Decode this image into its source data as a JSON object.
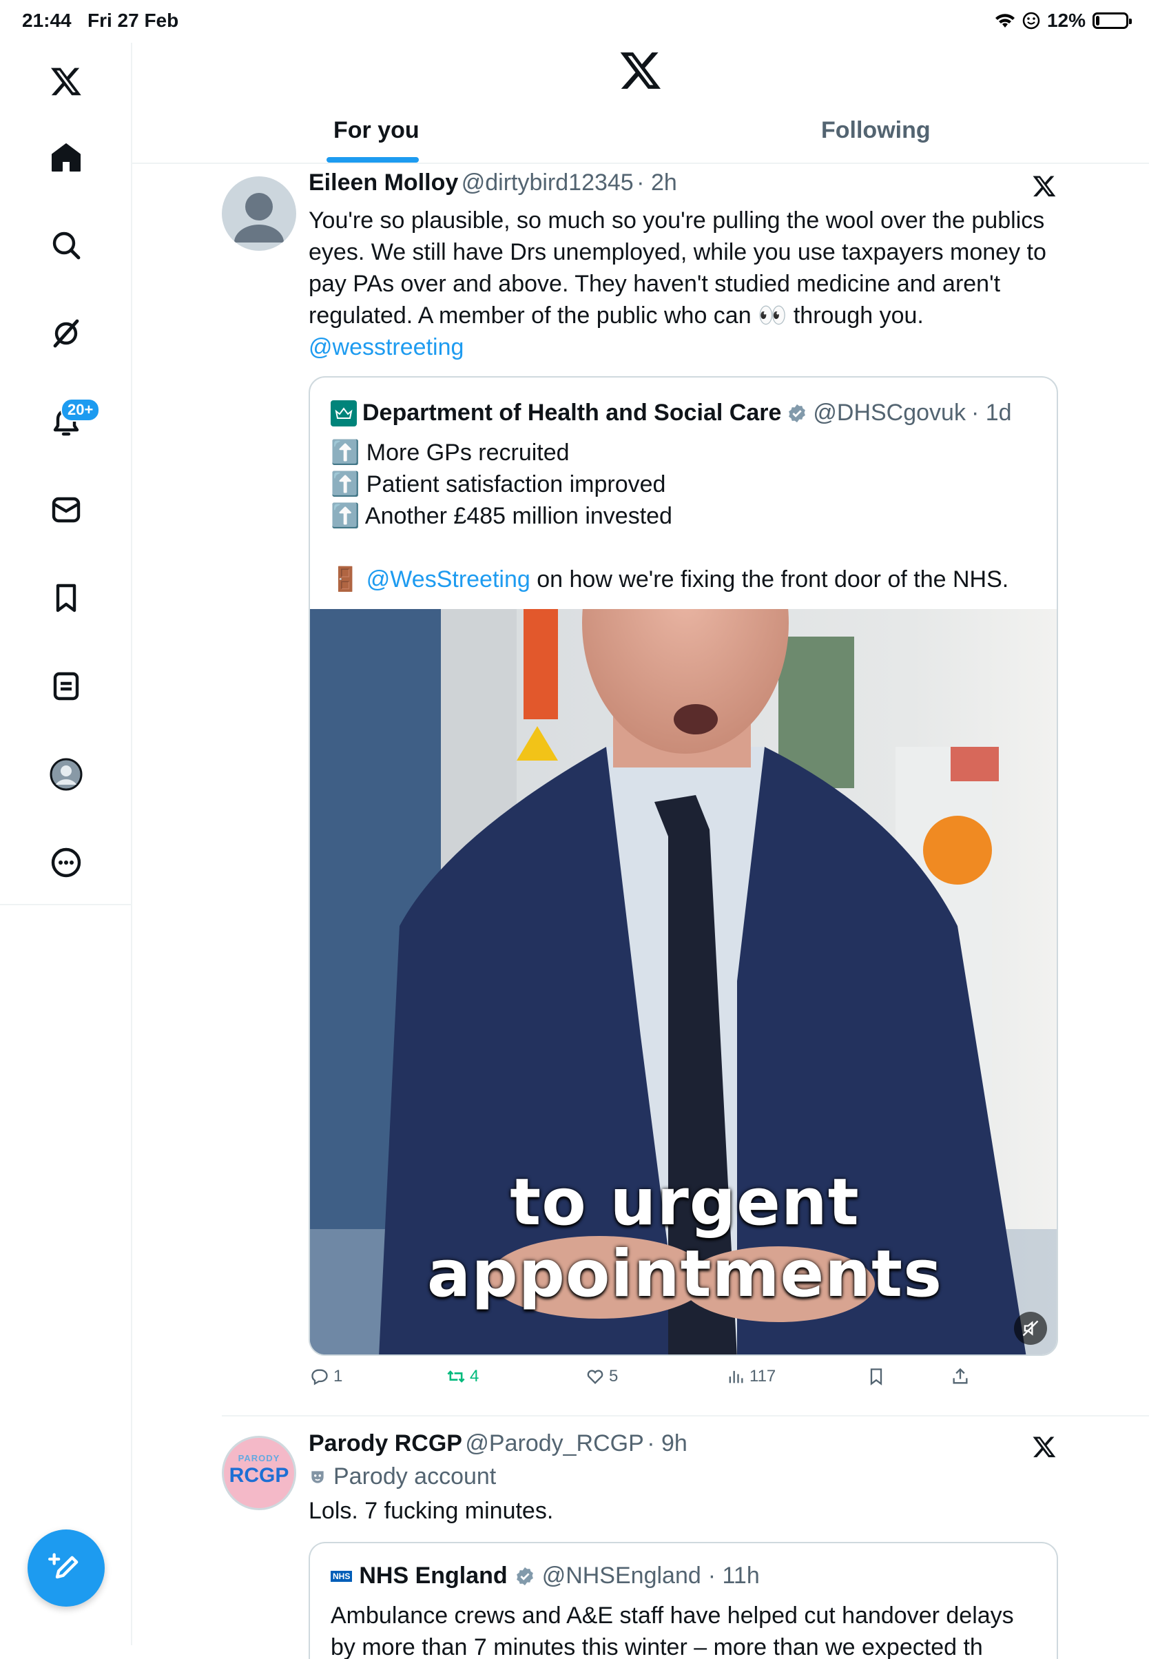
{
  "status_bar": {
    "time": "21:44",
    "date": "Fri 27 Feb",
    "battery": "12%",
    "battery_level": 0.12
  },
  "sidebar": {
    "items": [
      {
        "icon": "x-logo-icon"
      },
      {
        "icon": "home-icon"
      },
      {
        "icon": "search-icon"
      },
      {
        "icon": "grok-icon"
      },
      {
        "icon": "notifications-icon",
        "badge": "20+"
      },
      {
        "icon": "messages-icon"
      },
      {
        "icon": "bookmarks-icon"
      },
      {
        "icon": "lists-icon"
      },
      {
        "icon": "profile-icon"
      },
      {
        "icon": "more-icon"
      }
    ]
  },
  "header": {
    "tabs": [
      {
        "label": "For you"
      },
      {
        "label": "Following"
      }
    ]
  },
  "tweets": [
    {
      "name": "Eileen Molloy",
      "handle": "@dirtybird12345",
      "time": "· 2h",
      "text_lines": [
        "You're so plausible, so much so you're pulling the wool over the publics",
        "eyes. We still have Drs unemployed, while you use taxpayers money to",
        "pay PAs over and above. They haven't studied medicine and aren't",
        "regulated. A member of the public who can 👀  through you."
      ],
      "mention": "@wesstreeting",
      "quote": {
        "name": "Department of Health and Social Care",
        "handle": "@DHSCgovuk",
        "time": "· 1d",
        "lines": [
          "⬆️ More GPs recruited",
          "⬆️ Patient satisfaction improved",
          "⬆️ Another £485 million invested"
        ],
        "door_emoji": "🚪",
        "mention": "@WesStreeting",
        "rest": "on how we're fixing the front door of the NHS.",
        "video_caption_1": "to urgent",
        "video_caption_2": "appointments"
      },
      "actions": {
        "replies": "1",
        "retweets": "4",
        "likes": "5",
        "views": "117"
      }
    },
    {
      "name": "Parody RCGP",
      "handle": "@Parody_RCGP",
      "time": "· 9h",
      "parody_label": "Parody account",
      "text": "Lols. 7 fucking minutes.",
      "avatar_text_top": "PARODY",
      "avatar_text": "RCGP",
      "quote": {
        "name": "NHS England",
        "handle": "@NHSEngland",
        "time": "· 11h",
        "nhs_logo": "NHS",
        "line1": "Ambulance crews and A&E staff have helped cut handover delays",
        "line2": "by more than 7 minutes this winter – more than we expected th"
      }
    }
  ],
  "colors": {
    "accent": "#1d9bf0",
    "retweet": "#00ba7c",
    "muted": "#536471"
  }
}
